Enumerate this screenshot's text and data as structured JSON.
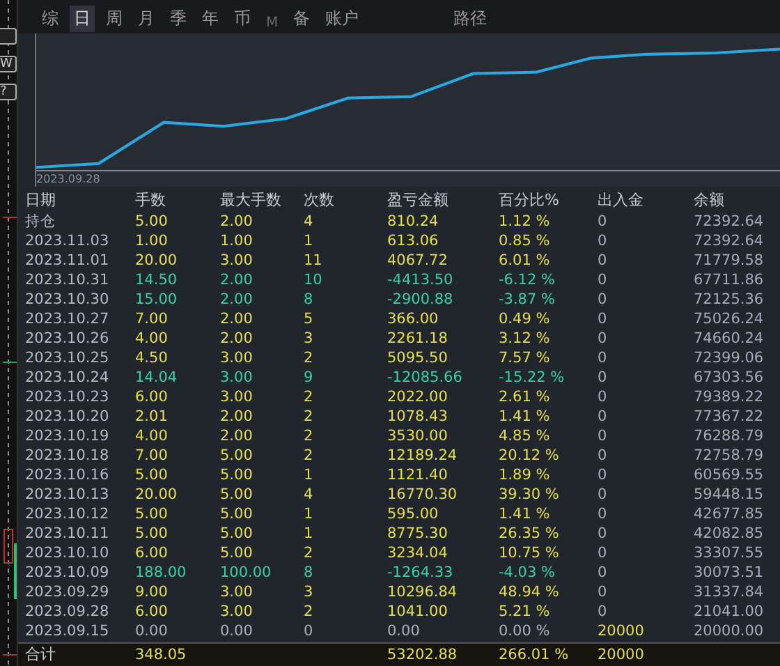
{
  "side_buttons": [
    "W",
    "?"
  ],
  "tabs": [
    {
      "label": "综",
      "selected": false,
      "disabled": false
    },
    {
      "label": "日",
      "selected": true,
      "disabled": false
    },
    {
      "label": "周",
      "selected": false,
      "disabled": false
    },
    {
      "label": "月",
      "selected": false,
      "disabled": false
    },
    {
      "label": "季",
      "selected": false,
      "disabled": false
    },
    {
      "label": "年",
      "selected": false,
      "disabled": false
    },
    {
      "label": "币",
      "selected": false,
      "disabled": false
    },
    {
      "label": "M",
      "selected": false,
      "disabled": true
    },
    {
      "label": "备",
      "selected": false,
      "disabled": false
    },
    {
      "label": "账户",
      "selected": false,
      "disabled": false
    }
  ],
  "path_label": "路径",
  "chart": {
    "start_label": "2023.09.28"
  },
  "table": {
    "columns": [
      "日期",
      "手数",
      "最大手数",
      "次数",
      "盈亏金额",
      "百分比%",
      "出入金",
      "余额"
    ],
    "rows": [
      {
        "kind": "gain",
        "deposit_active": false,
        "cells": [
          "持仓",
          "5.00",
          "2.00",
          "4",
          "810.24",
          "1.12 %",
          "0",
          "72392.64"
        ]
      },
      {
        "kind": "gain",
        "deposit_active": false,
        "cells": [
          "2023.11.03",
          "1.00",
          "1.00",
          "1",
          "613.06",
          "0.85 %",
          "0",
          "72392.64"
        ]
      },
      {
        "kind": "gain",
        "deposit_active": false,
        "cells": [
          "2023.11.01",
          "20.00",
          "3.00",
          "11",
          "4067.72",
          "6.01 %",
          "0",
          "71779.58"
        ]
      },
      {
        "kind": "loss",
        "deposit_active": false,
        "cells": [
          "2023.10.31",
          "14.50",
          "2.00",
          "10",
          "-4413.50",
          "-6.12 %",
          "0",
          "67711.86"
        ]
      },
      {
        "kind": "loss",
        "deposit_active": false,
        "cells": [
          "2023.10.30",
          "15.00",
          "2.00",
          "8",
          "-2900.88",
          "-3.87 %",
          "0",
          "72125.36"
        ]
      },
      {
        "kind": "gain",
        "deposit_active": false,
        "cells": [
          "2023.10.27",
          "7.00",
          "2.00",
          "5",
          "366.00",
          "0.49 %",
          "0",
          "75026.24"
        ]
      },
      {
        "kind": "gain",
        "deposit_active": false,
        "cells": [
          "2023.10.26",
          "4.00",
          "2.00",
          "3",
          "2261.18",
          "3.12 %",
          "0",
          "74660.24"
        ]
      },
      {
        "kind": "gain",
        "deposit_active": false,
        "cells": [
          "2023.10.25",
          "4.50",
          "3.00",
          "2",
          "5095.50",
          "7.57 %",
          "0",
          "72399.06"
        ]
      },
      {
        "kind": "loss",
        "deposit_active": false,
        "cells": [
          "2023.10.24",
          "14.04",
          "3.00",
          "9",
          "-12085.66",
          "-15.22 %",
          "0",
          "67303.56"
        ]
      },
      {
        "kind": "gain",
        "deposit_active": false,
        "cells": [
          "2023.10.23",
          "6.00",
          "3.00",
          "2",
          "2022.00",
          "2.61 %",
          "0",
          "79389.22"
        ]
      },
      {
        "kind": "gain",
        "deposit_active": false,
        "cells": [
          "2023.10.20",
          "2.01",
          "2.00",
          "2",
          "1078.43",
          "1.41 %",
          "0",
          "77367.22"
        ]
      },
      {
        "kind": "gain",
        "deposit_active": false,
        "cells": [
          "2023.10.19",
          "4.00",
          "2.00",
          "2",
          "3530.00",
          "4.85 %",
          "0",
          "76288.79"
        ]
      },
      {
        "kind": "gain",
        "deposit_active": false,
        "cells": [
          "2023.10.18",
          "7.00",
          "5.00",
          "2",
          "12189.24",
          "20.12 %",
          "0",
          "72758.79"
        ]
      },
      {
        "kind": "gain",
        "deposit_active": false,
        "cells": [
          "2023.10.16",
          "5.00",
          "5.00",
          "1",
          "1121.40",
          "1.89 %",
          "0",
          "60569.55"
        ]
      },
      {
        "kind": "gain",
        "deposit_active": false,
        "cells": [
          "2023.10.13",
          "20.00",
          "5.00",
          "4",
          "16770.30",
          "39.30 %",
          "0",
          "59448.15"
        ]
      },
      {
        "kind": "gain",
        "deposit_active": false,
        "cells": [
          "2023.10.12",
          "5.00",
          "5.00",
          "1",
          "595.00",
          "1.41 %",
          "0",
          "42677.85"
        ]
      },
      {
        "kind": "gain",
        "deposit_active": false,
        "cells": [
          "2023.10.11",
          "5.00",
          "5.00",
          "1",
          "8775.30",
          "26.35 %",
          "0",
          "42082.85"
        ]
      },
      {
        "kind": "gain",
        "deposit_active": false,
        "cells": [
          "2023.10.10",
          "6.00",
          "5.00",
          "2",
          "3234.04",
          "10.75 %",
          "0",
          "33307.55"
        ]
      },
      {
        "kind": "loss",
        "deposit_active": false,
        "cells": [
          "2023.10.09",
          "188.00",
          "100.00",
          "8",
          "-1264.33",
          "-4.03 %",
          "0",
          "30073.51"
        ]
      },
      {
        "kind": "gain",
        "deposit_active": false,
        "cells": [
          "2023.09.29",
          "9.00",
          "3.00",
          "3",
          "10296.84",
          "48.94 %",
          "0",
          "31337.84"
        ]
      },
      {
        "kind": "gain",
        "deposit_active": false,
        "cells": [
          "2023.09.28",
          "6.00",
          "3.00",
          "2",
          "1041.00",
          "5.21 %",
          "0",
          "21041.00"
        ]
      },
      {
        "kind": "flat",
        "deposit_active": true,
        "cells": [
          "2023.09.15",
          "0.00",
          "0.00",
          "0",
          "0.00",
          "0.00 %",
          "20000",
          "20000.00"
        ]
      }
    ],
    "total": {
      "label": "合计",
      "lots": "348.05",
      "profit": "53202.88",
      "percent": "266.01 %",
      "deposit": "20000"
    }
  }
}
